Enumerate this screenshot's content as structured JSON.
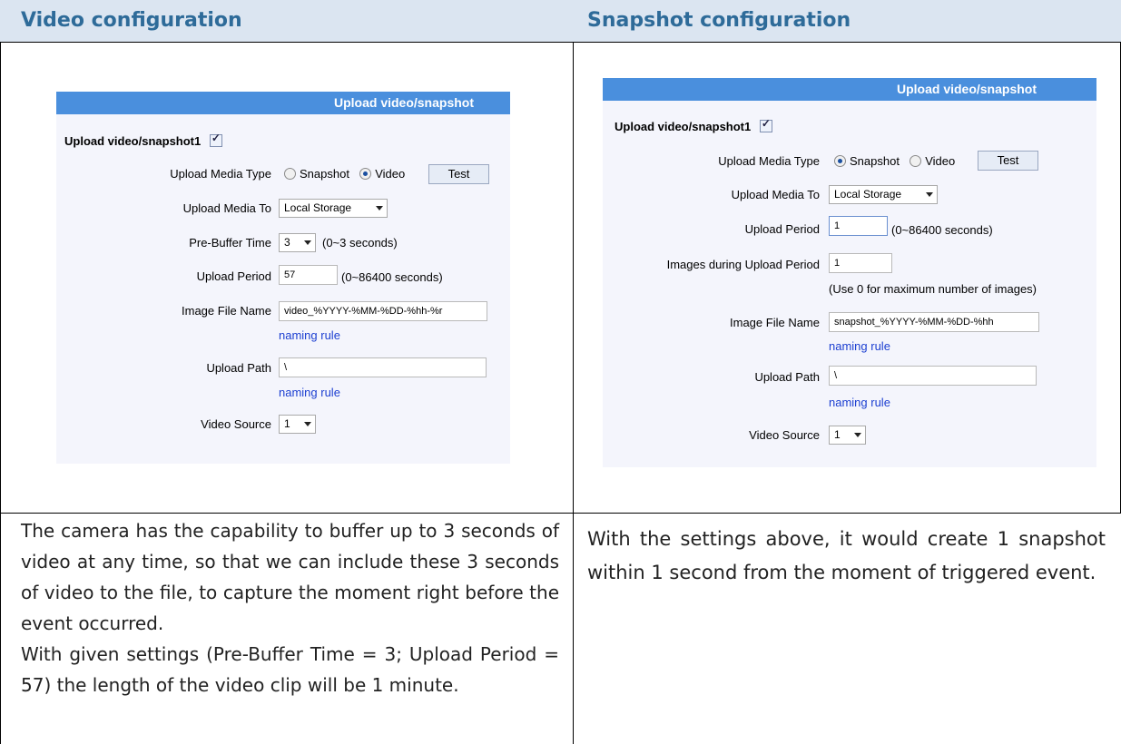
{
  "left": {
    "heading": "Video configuration",
    "panel": {
      "title": "Upload video/snapshot",
      "upload_label": "Upload video/snapshot1",
      "media_type_label": "Upload Media Type",
      "opt_snapshot": "Snapshot",
      "opt_video": "Video",
      "selected_media": "Video",
      "test_button": "Test",
      "media_to_label": "Upload Media To",
      "media_to_value": "Local Storage",
      "prebuffer_label": "Pre-Buffer Time",
      "prebuffer_value": "3",
      "prebuffer_hint": "(0~3 seconds)",
      "period_label": "Upload Period",
      "period_value": "57",
      "period_hint": "(0~86400 seconds)",
      "filename_label": "Image File Name",
      "filename_value": "video_%YYYY-%MM-%DD-%hh-%r",
      "naming_rule_1": "naming rule",
      "path_label": "Upload Path",
      "path_value": "\\",
      "naming_rule_2": "naming rule",
      "source_label": "Video Source",
      "source_value": "1"
    },
    "description_1": "The camera has the capability to buffer up to 3 seconds of video at any time, so that we can include these 3 seconds of video to the file, to capture the moment right before the event occurred.",
    "description_2": "With given settings (Pre-Buffer Time = 3; Upload Period = 57)  the length of the video clip will be 1 minute."
  },
  "right": {
    "heading": "Snapshot configuration",
    "panel": {
      "title": "Upload video/snapshot",
      "upload_label": "Upload video/snapshot1",
      "media_type_label": "Upload Media Type",
      "opt_snapshot": "Snapshot",
      "opt_video": "Video",
      "selected_media": "Snapshot",
      "test_button": "Test",
      "media_to_label": "Upload Media To",
      "media_to_value": "Local Storage",
      "period_label": "Upload Period",
      "period_value": "1",
      "period_hint": "(0~86400 seconds)",
      "images_label": "Images during Upload Period",
      "images_value": "1",
      "images_hint": "(Use 0 for maximum number of images)",
      "filename_label": "Image File Name",
      "filename_value": "snapshot_%YYYY-%MM-%DD-%hh",
      "naming_rule_1": "naming rule",
      "path_label": "Upload Path",
      "path_value": "\\",
      "naming_rule_2": "naming rule",
      "source_label": "Video Source",
      "source_value": "1"
    },
    "description": "With the settings above, it would create 1 snapshot within 1 second from the moment of triggered event."
  },
  "colors": {
    "header_bg": "#dbe5f1",
    "header_text": "#2e6b99",
    "panel_title_bg": "#4a8fdd",
    "panel_bg": "#f4f5fc",
    "link": "#1c3fd1"
  }
}
